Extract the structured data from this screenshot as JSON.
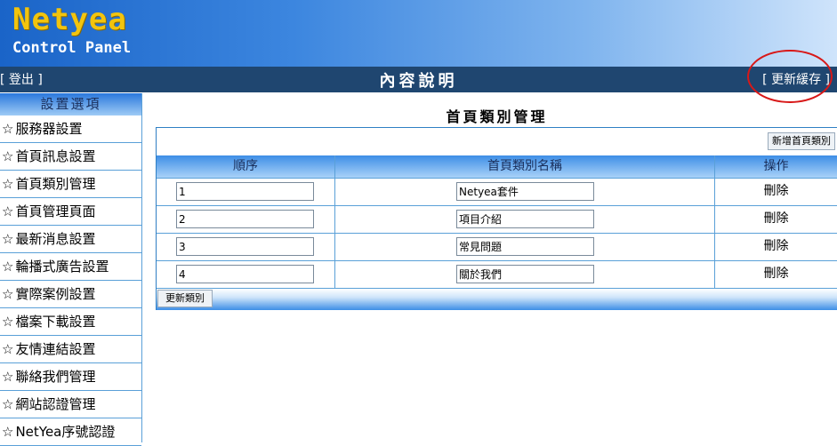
{
  "header": {
    "logo_title": "Netyea",
    "logo_subtitle": "Control Panel"
  },
  "navbar": {
    "logout_label": "[ 登出 ]",
    "title": "內容說明",
    "refresh_cache_label": "[ 更新緩存 ]"
  },
  "sidebar": {
    "header": "設置選項",
    "items": [
      {
        "label": "服務器設置"
      },
      {
        "label": "首頁訊息設置"
      },
      {
        "label": "首頁類別管理"
      },
      {
        "label": "首頁管理頁面"
      },
      {
        "label": "最新消息設置"
      },
      {
        "label": "輪播式廣告設置"
      },
      {
        "label": "實際案例設置"
      },
      {
        "label": "檔案下載設置"
      },
      {
        "label": "友情連結設置"
      },
      {
        "label": "聯絡我們管理"
      },
      {
        "label": "網站認證管理"
      },
      {
        "label": "NetYea序號認證"
      }
    ]
  },
  "main": {
    "title": "首頁類別管理",
    "add_button_label": "新增首頁類別",
    "columns": [
      "順序",
      "首頁類別名稱",
      "操作"
    ],
    "rows": [
      {
        "order": "1",
        "name": "Netyea套件",
        "action": "刪除"
      },
      {
        "order": "2",
        "name": "項目介紹",
        "action": "刪除"
      },
      {
        "order": "3",
        "name": "常見問題",
        "action": "刪除"
      },
      {
        "order": "4",
        "name": "關於我們",
        "action": "刪除"
      }
    ],
    "update_button_label": "更新類別"
  },
  "colors": {
    "logo": "#f2c40e",
    "navbar": "#1f4670",
    "border": "#5aa0d8",
    "annotation": "#d81818"
  }
}
